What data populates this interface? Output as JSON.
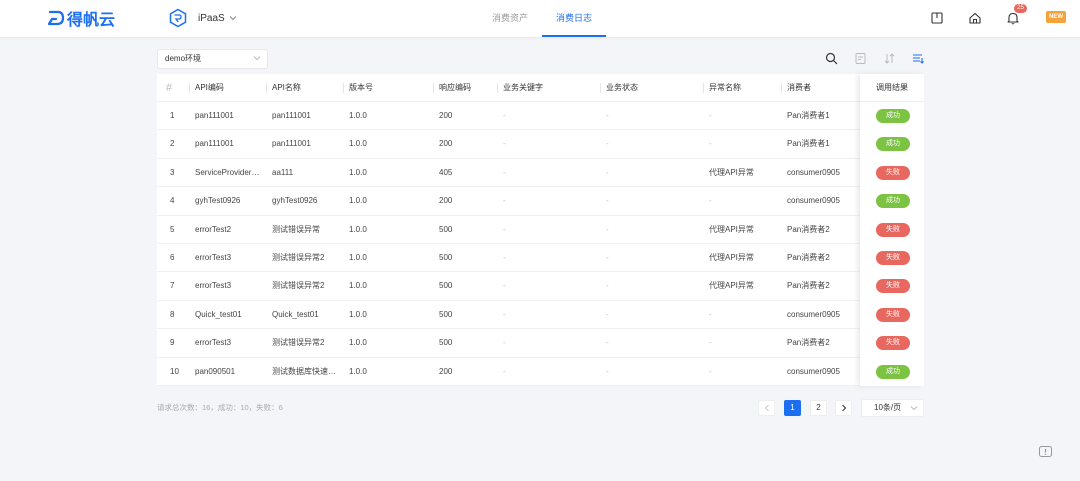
{
  "brand": {
    "logo_text": "得帆云",
    "accent": "#1d6ff2"
  },
  "app_switch": {
    "name": "iPaaS"
  },
  "nav": {
    "tabs": [
      {
        "label": "消费资产",
        "active": false
      },
      {
        "label": "消费日志",
        "active": true
      }
    ]
  },
  "header_icons": {
    "notifications_count": "25",
    "new_badge": "NEW"
  },
  "toolbar": {
    "environment": "demo环境"
  },
  "table": {
    "columns": [
      "#",
      "API编码",
      "API名称",
      "版本号",
      "响应编码",
      "业务关键字",
      "业务状态",
      "异常名称",
      "消费者",
      "调用结果"
    ],
    "rows": [
      {
        "idx": "1",
        "api_code": "pan111001",
        "api_name": "pan111001",
        "version": "1.0.0",
        "resp": "200",
        "biz_key": "-",
        "biz_status": "-",
        "error": "-",
        "consumer": "Pan消费者1",
        "result": "成功",
        "ok": true
      },
      {
        "idx": "2",
        "api_code": "pan111001",
        "api_name": "pan111001",
        "version": "1.0.0",
        "resp": "200",
        "biz_key": "-",
        "biz_status": "-",
        "error": "-",
        "consumer": "Pan消费者1",
        "result": "成功",
        "ok": true
      },
      {
        "idx": "3",
        "api_code": "ServiceProvider…",
        "api_name": "aa111",
        "version": "1.0.0",
        "resp": "405",
        "biz_key": "-",
        "biz_status": "-",
        "error": "代理API异常",
        "consumer": "consumer0905",
        "result": "失败",
        "ok": false
      },
      {
        "idx": "4",
        "api_code": "gyhTest0926",
        "api_name": "gyhTest0926",
        "version": "1.0.0",
        "resp": "200",
        "biz_key": "-",
        "biz_status": "-",
        "error": "-",
        "consumer": "consumer0905",
        "result": "成功",
        "ok": true
      },
      {
        "idx": "5",
        "api_code": "errorTest2",
        "api_name": "测试错误异常",
        "version": "1.0.0",
        "resp": "500",
        "biz_key": "-",
        "biz_status": "-",
        "error": "代理API异常",
        "consumer": "Pan消费者2",
        "result": "失败",
        "ok": false
      },
      {
        "idx": "6",
        "api_code": "errorTest3",
        "api_name": "测试错误异常2",
        "version": "1.0.0",
        "resp": "500",
        "biz_key": "-",
        "biz_status": "-",
        "error": "代理API异常",
        "consumer": "Pan消费者2",
        "result": "失败",
        "ok": false
      },
      {
        "idx": "7",
        "api_code": "errorTest3",
        "api_name": "测试错误异常2",
        "version": "1.0.0",
        "resp": "500",
        "biz_key": "-",
        "biz_status": "-",
        "error": "代理API异常",
        "consumer": "Pan消费者2",
        "result": "失败",
        "ok": false
      },
      {
        "idx": "8",
        "api_code": "Quick_test01",
        "api_name": "Quick_test01",
        "version": "1.0.0",
        "resp": "500",
        "biz_key": "-",
        "biz_status": "-",
        "error": "-",
        "consumer": "consumer0905",
        "result": "失败",
        "ok": false
      },
      {
        "idx": "9",
        "api_code": "errorTest3",
        "api_name": "测试错误异常2",
        "version": "1.0.0",
        "resp": "500",
        "biz_key": "-",
        "biz_status": "-",
        "error": "-",
        "consumer": "Pan消费者2",
        "result": "失败",
        "ok": false
      },
      {
        "idx": "10",
        "api_code": "pan090501",
        "api_name": "测试数据库快速…",
        "version": "1.0.0",
        "resp": "200",
        "biz_key": "-",
        "biz_status": "-",
        "error": "-",
        "consumer": "consumer0905",
        "result": "成功",
        "ok": true
      }
    ]
  },
  "footer": {
    "summary": "请求总次数：16，成功：10，失败：6",
    "pages": [
      "1",
      "2"
    ],
    "current_page": "1",
    "page_size": "10条/页"
  }
}
